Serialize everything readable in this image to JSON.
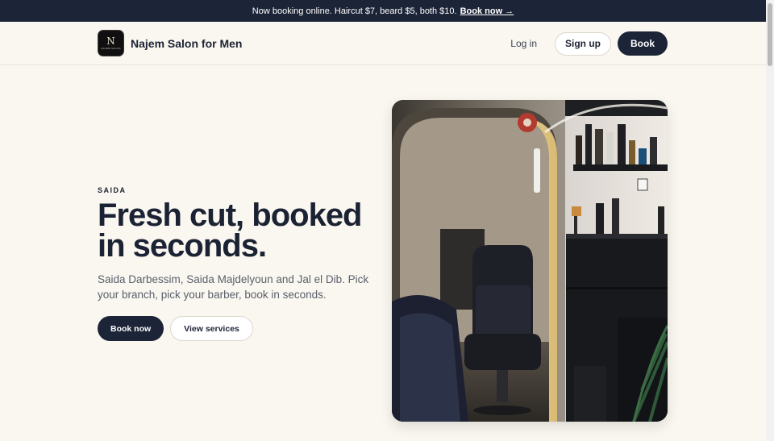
{
  "announcement": {
    "text": "Now booking online. Haircut $7, beard $5, both $10.",
    "link_label": "Book now →"
  },
  "header": {
    "logo_mark": "N",
    "logo_small_text": "NAJEM SALON",
    "brand_name": "Najem Salon for Men",
    "login_label": "Log in",
    "signup_label": "Sign up",
    "book_label": "Book"
  },
  "hero": {
    "eyebrow": "SAIDA",
    "headline": "Fresh cut, booked in seconds.",
    "subtext": "Saida Darbessim, Saida Majdelyoun and Jal el Dib. Pick your branch, pick your barber, book in seconds.",
    "primary_cta": "Book now",
    "secondary_cta": "View services"
  },
  "colors": {
    "navy": "#1c2437",
    "background": "#faf7f0",
    "white": "#ffffff"
  }
}
